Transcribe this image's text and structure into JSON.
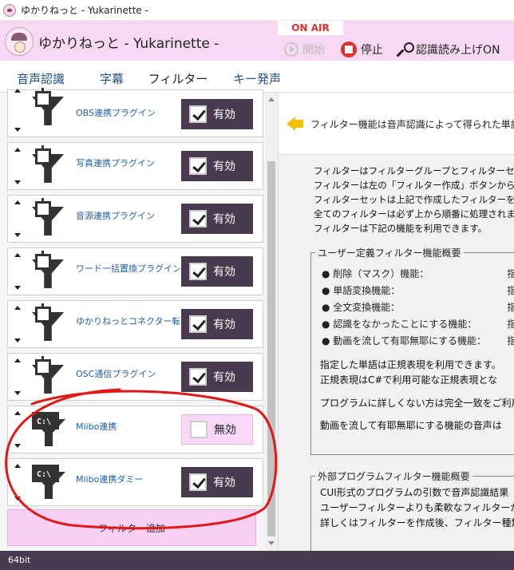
{
  "window": {
    "title": "ゆかりねっと - Yukarinette -"
  },
  "header": {
    "app_title": "ゆかりねっと - Yukarinette -",
    "on_air": "ON AIR",
    "start_label": "開始",
    "stop_label": "停止",
    "read_label": "認識読み上げON"
  },
  "tabs": [
    {
      "label": "音声認識"
    },
    {
      "label": "字幕"
    },
    {
      "label": "フィルター"
    },
    {
      "label": "キー発声"
    }
  ],
  "filters": [
    {
      "name": "OBS連携プラグイン",
      "state": "有効",
      "enabled": true
    },
    {
      "name": "写真連携プラグイン",
      "state": "有効",
      "enabled": true
    },
    {
      "name": "音源連携プラグイン",
      "state": "有効",
      "enabled": true
    },
    {
      "name": "ワード一括置換プラグイン",
      "state": "有効",
      "enabled": true
    },
    {
      "name": "ゆかりねっとコネクター転送",
      "state": "有効",
      "enabled": true
    },
    {
      "name": "OSC通信プラグイン",
      "state": "有効",
      "enabled": true
    },
    {
      "name": "Miibo連携",
      "state": "無効",
      "enabled": false
    },
    {
      "name": "Miibo連携ダミー",
      "state": "有効",
      "enabled": true
    }
  ],
  "cmd_icon_text": "C:\\",
  "add_filter_label": "フィルター追加",
  "right": {
    "info": "フィルター機能は音声認識によって得られた単語",
    "lines": [
      "フィルターはフィルターグループとフィルターセットで構",
      "フィルターは左の「フィルター作成」ボタンから作成",
      "フィルターセットは上記で作成したフィルターを選",
      "全てのフィルターは必ず上から順番に処理されま",
      "フィルターは下記の機能を利用できます。"
    ],
    "user_group": {
      "title": "ユーザー定義フィルター機能概要",
      "items": [
        {
          "label": "削除（マスク）機能：",
          "value": "指定"
        },
        {
          "label": "単語変換機能：",
          "value": "指定"
        },
        {
          "label": "全文変換機能：",
          "value": "指定"
        },
        {
          "label": "認識をなかったことにする機能：",
          "value": "指定"
        },
        {
          "label": "動画を流して有耶無耶にする機能：",
          "value": "指定"
        }
      ],
      "notes": [
        "指定した単語は正規表現を利用できます。",
        "正規表現はC#で利用可能な正規表現とな",
        "プログラムに詳しくない方は完全一致をご利用",
        "動画を流して有耶無耶にする機能の音声は"
      ]
    },
    "ext_group": {
      "title": "外部プログラムフィルター機能概要",
      "lines": [
        "CUI形式のプログラムの引数で音声認識結果",
        "ユーザーフィルターよりも柔軟なフィルターが可能",
        "詳しくはフィルターを作成後、フィルター種類を"
      ]
    }
  },
  "status": {
    "text": "64bit"
  },
  "colors": {
    "header_bg": "#f8d9f4",
    "toggle_on": "#4a3a4f",
    "toggle_off": "#f9d8f7",
    "onair": "#e0302e",
    "annotation": "#e01818"
  }
}
